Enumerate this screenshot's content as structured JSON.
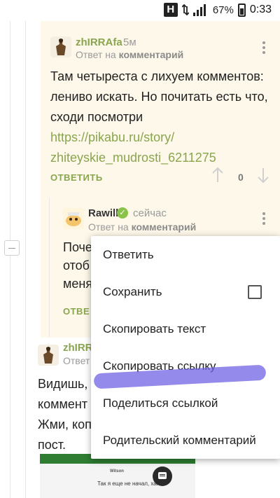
{
  "status_bar": {
    "h_indicator": "H",
    "battery": "67%",
    "time": "0:33"
  },
  "comment1": {
    "username": "zhIRRAfa",
    "time": "5м",
    "reply_prefix": "Ответ на",
    "reply_target": "комментарий",
    "text_line1": "Там четыреста с лихуем комментов:",
    "text_line2": "лениво искать. Но почитать есть что,",
    "text_line3": "сходи посмотри",
    "link_line1": "https://pikabu.ru/story/",
    "link_line2": "zhiteyskie_mudrosti_6211275",
    "reply_label": "ОТВЕТИТЬ",
    "rating": "0"
  },
  "comment2": {
    "username": "Rawill",
    "time": "сейчас",
    "reply_prefix": "Ответ на",
    "reply_target": "комментарий",
    "text_line1": "Поче",
    "text_line2": "отоб",
    "text_line3": "меня",
    "reply_label": "ОТВЕ"
  },
  "comment3": {
    "username": "zhIRRA",
    "reply_prefix": "Ответ",
    "text_line1": "Видишь,",
    "text_line2": "коммент",
    "text_line3": "Жми, коп",
    "text_line4": "пост.",
    "thumb_name": "Witson",
    "thumb_text": "Так я еще не начал, хах."
  },
  "menu": {
    "items": [
      {
        "label": "Ответить"
      },
      {
        "label": "Сохранить"
      },
      {
        "label": "Скопировать текст"
      },
      {
        "label": "Скопировать ссылку"
      },
      {
        "label": "Поделиться ссылкой"
      },
      {
        "label": "Родительский комментарий"
      }
    ]
  },
  "colors": {
    "accent": "#8aa54f",
    "highlight_bg": "#fdf8e9",
    "scribble": "#6f63e6"
  }
}
